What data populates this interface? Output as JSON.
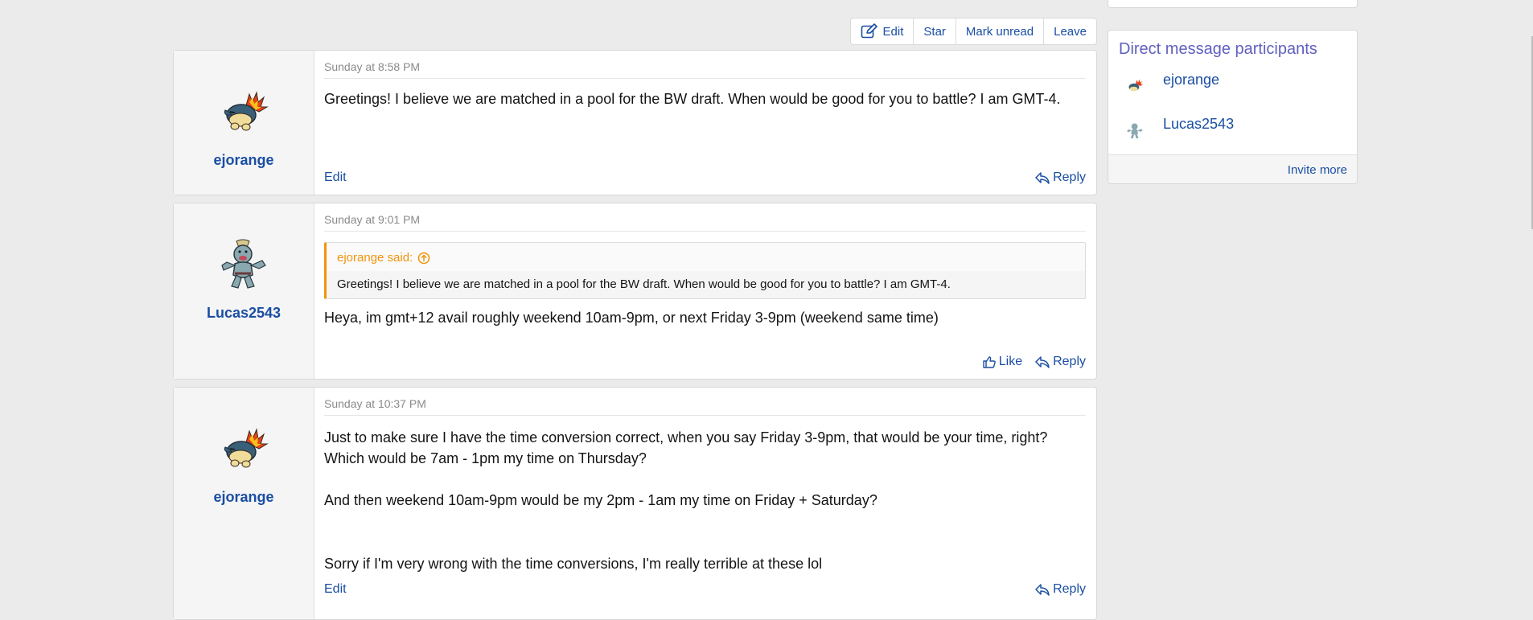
{
  "actions": {
    "edit": "Edit",
    "star": "Star",
    "mark_unread": "Mark unread",
    "leave": "Leave"
  },
  "messages": [
    {
      "author": "ejorange",
      "date": "Sunday at 8:58 PM",
      "body": [
        "Greetings! I believe we are matched in a pool for the BW draft. When would be good for you to battle? I am GMT-4."
      ],
      "edit": "Edit",
      "reply": "Reply"
    },
    {
      "author": "Lucas2543",
      "date": "Sunday at 9:01 PM",
      "quote_author": "ejorange said:",
      "quote_text": "Greetings! I believe we are matched in a pool for the BW draft. When would be good for you to battle? I am GMT-4.",
      "body": [
        "Heya, im gmt+12 avail roughly weekend 10am-9pm, or next Friday 3-9pm (weekend same time)"
      ],
      "like": "Like",
      "reply": "Reply"
    },
    {
      "author": "ejorange",
      "date": "Sunday at 10:37 PM",
      "body": [
        "Just to make sure I have the time conversion correct, when you say Friday 3-9pm, that would be your time, right? Which would be 7am - 1pm my time on Thursday?",
        "And then weekend 10am-9pm would be my 2pm - 1am my time on Friday + Saturday?",
        "Sorry if I'm very wrong with the time conversions, I'm really terrible at these lol"
      ],
      "edit": "Edit",
      "reply": "Reply"
    }
  ],
  "sidebar": {
    "title": "Direct message participants",
    "participants": [
      "ejorange",
      "Lucas2543"
    ],
    "invite": "Invite more"
  },
  "colors": {
    "link": "#1a4ea3",
    "quote_accent": "#f2930d",
    "sidebar_title": "#6060c0"
  }
}
